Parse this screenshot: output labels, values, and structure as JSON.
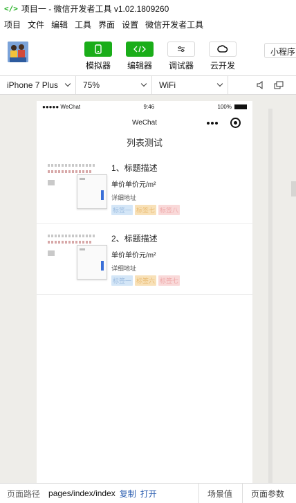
{
  "window": {
    "title": "项目一 - 微信开发者工具 v1.02.1809260",
    "logo_glyph": "</>"
  },
  "menu": [
    "项目",
    "文件",
    "编辑",
    "工具",
    "界面",
    "设置",
    "微信开发者工具"
  ],
  "toolbar": {
    "tools": [
      {
        "label": "模拟器",
        "icon": "phone-icon",
        "active": true
      },
      {
        "label": "编辑器",
        "icon": "code-icon",
        "active": true
      },
      {
        "label": "调试器",
        "icon": "debug-icon",
        "active": false
      },
      {
        "label": "云开发",
        "icon": "cloud-icon",
        "active": false
      }
    ],
    "mini_program": "小程序"
  },
  "device_bar": {
    "device": "iPhone 7 Plus",
    "zoom": "75%",
    "network": "WiFi"
  },
  "phone": {
    "status": {
      "signal": "●●●●● WeChat",
      "time": "9:46",
      "battery": "100%"
    },
    "nav_title": "WeChat",
    "page_title": "列表测试",
    "items": [
      {
        "title": "1、标题描述",
        "price": "单价单价元/m²",
        "address": "详细地址",
        "tags": [
          "标签一",
          "标签七",
          "标签八"
        ]
      },
      {
        "title": "2、标题描述",
        "price": "单价单价元/m²",
        "address": "详细地址",
        "tags": [
          "标签一",
          "标签六",
          "标签七"
        ]
      }
    ]
  },
  "bottom_bar": {
    "path_label": "页面路径",
    "path_value": "pages/index/index",
    "copy": "复制",
    "open": "打开",
    "scene": "场景值",
    "params": "页面参数"
  },
  "colors": {
    "accent": "#1aad19",
    "link": "#2a5db0"
  }
}
